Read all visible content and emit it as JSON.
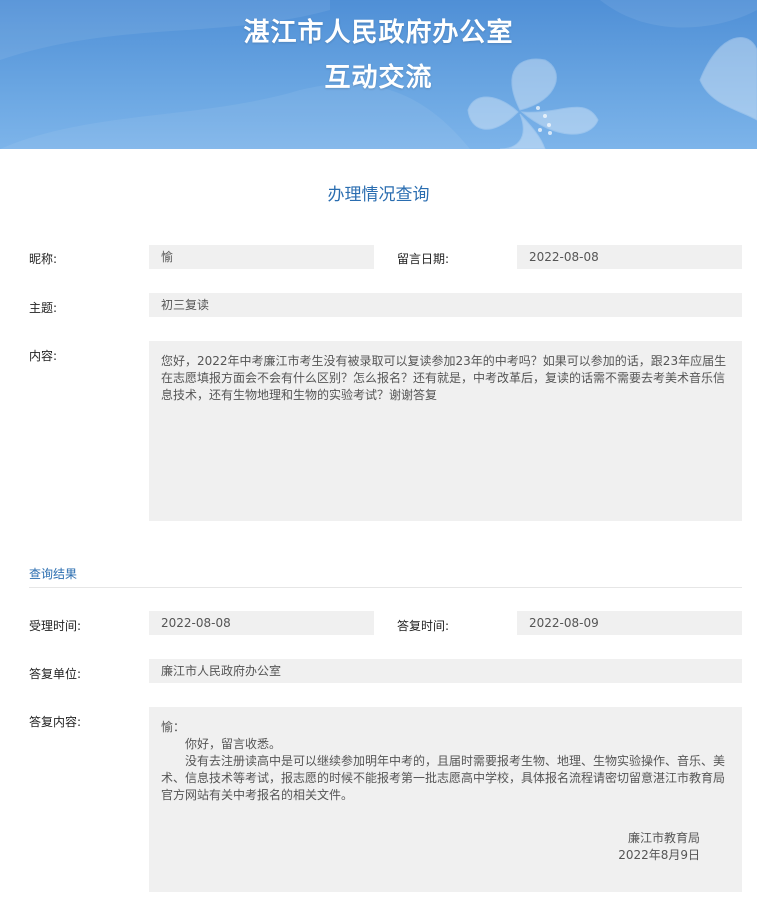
{
  "header": {
    "title_line1": "湛江市人民政府办公室",
    "title_line2": "互动交流",
    "bg_color": "#5b9ada"
  },
  "page_title": "办理情况查询",
  "message": {
    "nickname_label": "昵称:",
    "nickname": "愉",
    "date_label": "留言日期:",
    "date": "2022-08-08",
    "subject_label": "主题:",
    "subject": "初三复读",
    "content_label": "内容:",
    "content": "您好，2022年中考廉江市考生没有被录取可以复读参加23年的中考吗？如果可以参加的话，跟23年应届生在志愿填报方面会不会有什么区别？怎么报名？还有就是，中考改革后，复读的话需不需要去考美术音乐信息技术，还有生物地理和生物的实验考试？谢谢答复"
  },
  "result": {
    "section_title": "查询结果",
    "accept_time_label": "受理时间:",
    "accept_time": "2022-08-08",
    "reply_time_label": "答复时间:",
    "reply_time": "2022-08-09",
    "reply_unit_label": "答复单位:",
    "reply_unit": "廉江市人民政府办公室",
    "reply_content_label": "答复内容:",
    "reply_greeting": "愉：",
    "reply_line1": "你好，留言收悉。",
    "reply_line2": "没有去注册读高中是可以继续参加明年中考的，且届时需要报考生物、地理、生物实验操作、音乐、美术、信息技术等考试，报志愿的时候不能报考第一批志愿高中学校，具体报名流程请密切留意湛江市教育局官方网站有关中考报名的相关文件。",
    "reply_sign_org": "廉江市教育局",
    "reply_sign_date": "2022年8月9日"
  },
  "colors": {
    "accent": "#2a6db0",
    "field_bg": "#f0f0f0"
  }
}
